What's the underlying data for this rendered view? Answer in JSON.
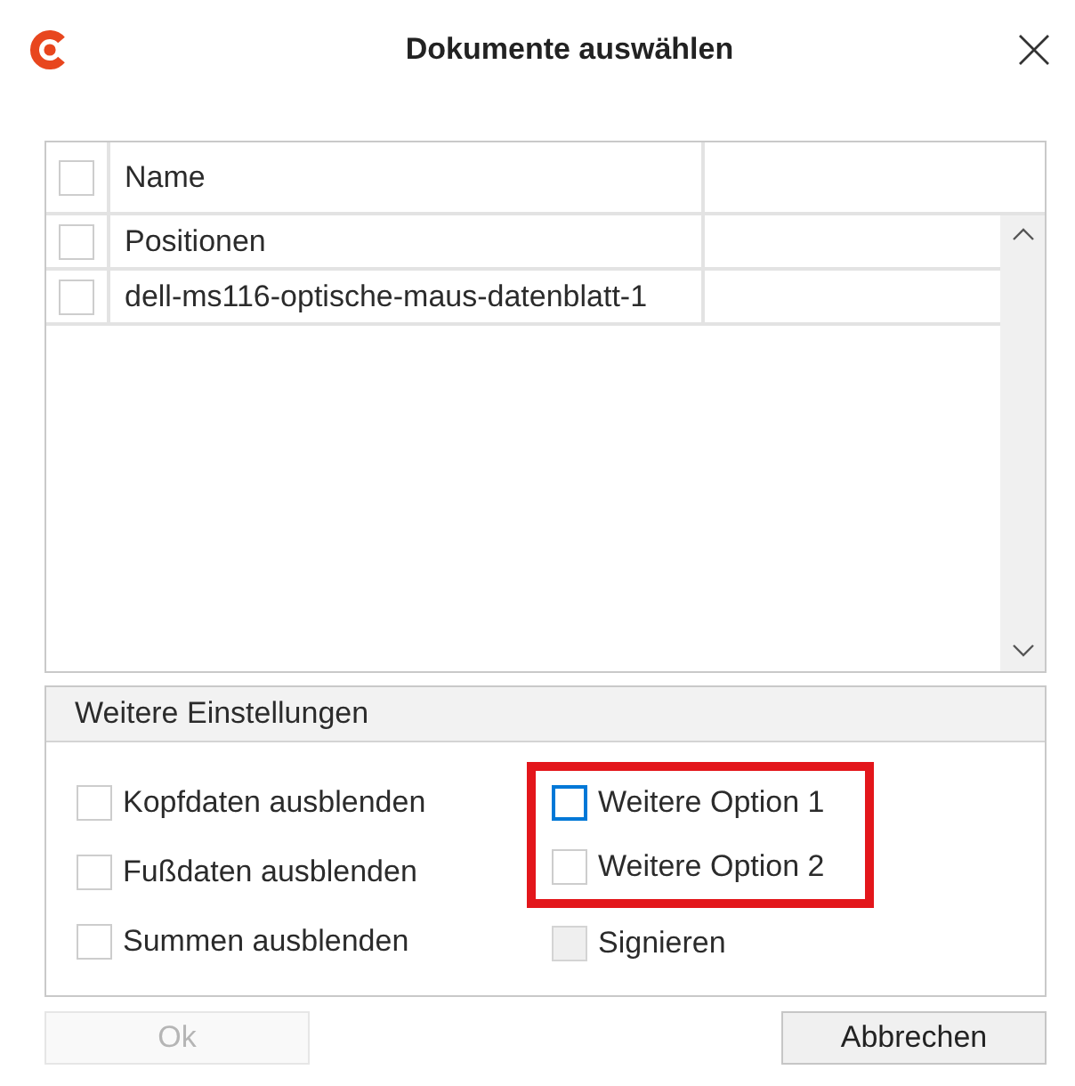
{
  "window": {
    "title": "Dokumente auswählen"
  },
  "table": {
    "select_all": {
      "checked": false
    },
    "columns": [
      {
        "label": "Name"
      }
    ],
    "rows": [
      {
        "cells": [
          "Positionen"
        ],
        "checked": false
      },
      {
        "cells": [
          "dell-ms116-optische-maus-datenblatt-1"
        ],
        "checked": false
      }
    ]
  },
  "settings": {
    "title": "Weitere Einstellungen",
    "columns": [
      [
        {
          "label": "Kopfdaten ausblenden",
          "checked": false,
          "focused": false,
          "disabled": false,
          "highlighted": false
        },
        {
          "label": "Fußdaten ausblenden",
          "checked": false,
          "focused": false,
          "disabled": false,
          "highlighted": false
        },
        {
          "label": "Summen ausblenden",
          "checked": false,
          "focused": false,
          "disabled": false,
          "highlighted": false
        }
      ],
      [
        {
          "label": "Weitere Option 1",
          "checked": false,
          "focused": true,
          "disabled": false,
          "highlighted": true
        },
        {
          "label": "Weitere Option 2",
          "checked": false,
          "focused": false,
          "disabled": false,
          "highlighted": true
        },
        {
          "label": "Signieren",
          "checked": false,
          "focused": false,
          "disabled": true,
          "highlighted": false
        }
      ]
    ]
  },
  "buttons": [
    {
      "label": "Ok",
      "disabled": true
    },
    {
      "label": "Abbrechen",
      "disabled": false
    }
  ]
}
